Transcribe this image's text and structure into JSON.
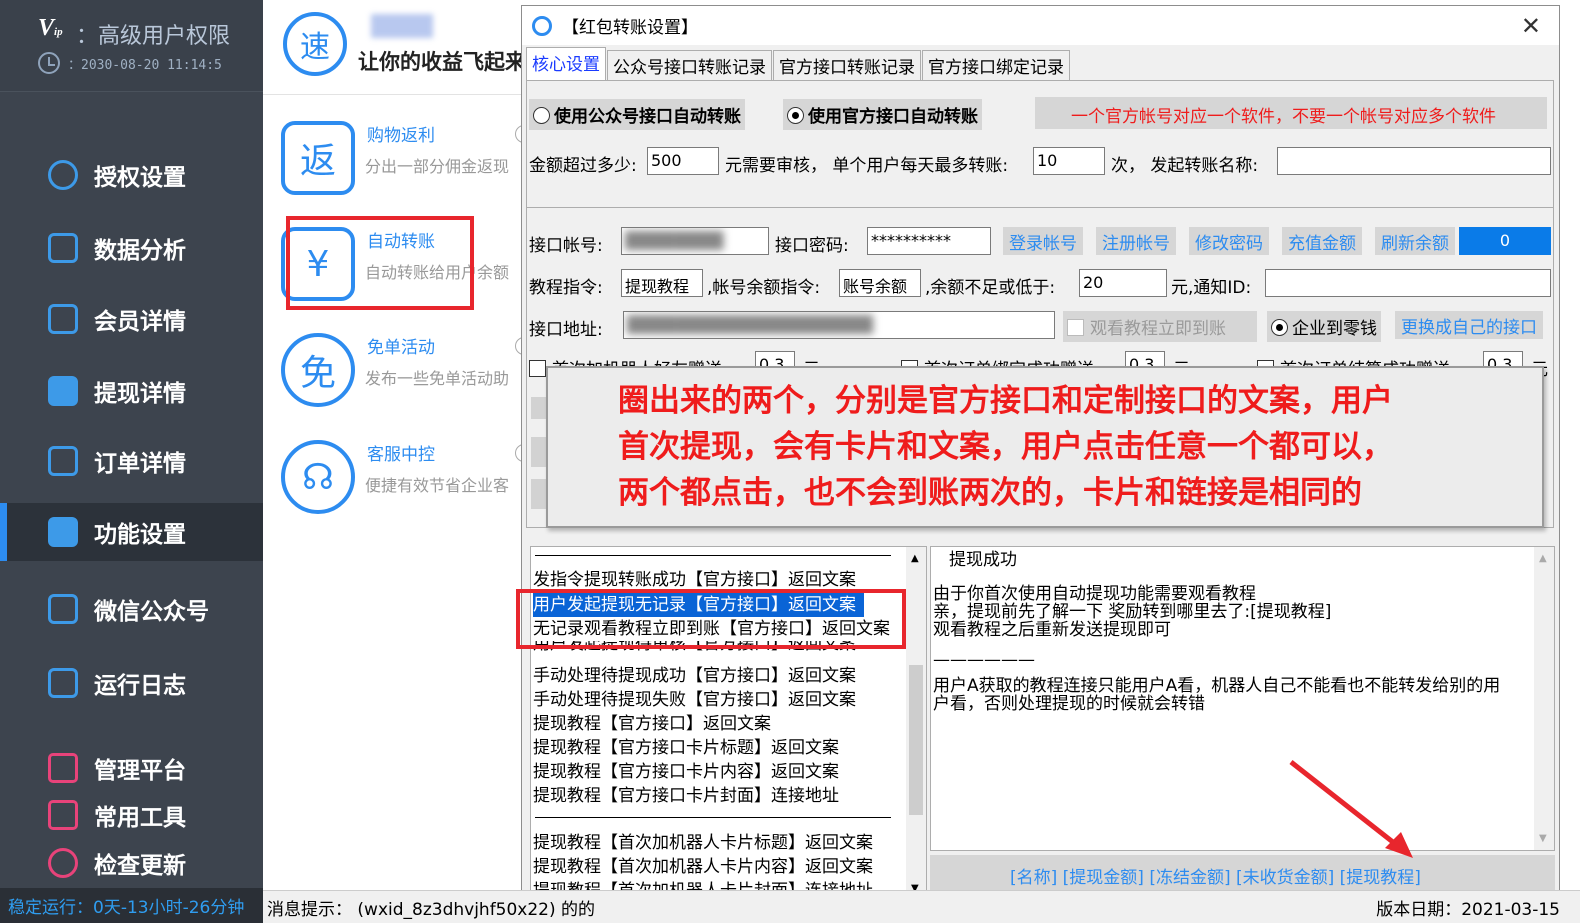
{
  "sidebar": {
    "vip_label": "：高级用户权限",
    "expiry": "：2030-08-20 11:14:5",
    "items": [
      {
        "label": "授权设置",
        "icon": "globe-icon"
      },
      {
        "label": "数据分析",
        "icon": "monitor-chart-icon"
      },
      {
        "label": "会员详情",
        "icon": "external-link-icon"
      },
      {
        "label": "提现详情",
        "icon": "grid-search-icon"
      },
      {
        "label": "订单详情",
        "icon": "document-yen-icon"
      },
      {
        "label": "功能设置",
        "icon": "wechat-icon"
      },
      {
        "label": "微信公众号",
        "icon": "wechat-official-icon"
      },
      {
        "label": "运行日志",
        "icon": "speaker-icon"
      },
      {
        "label": "管理平台",
        "icon": "platform-icon"
      },
      {
        "label": "常用工具",
        "icon": "tools-chart-icon"
      },
      {
        "label": "检查更新",
        "icon": "update-icon"
      }
    ],
    "uptime": "稳定运行：0天-13小时-26分钟"
  },
  "middle": {
    "logo_char": "速",
    "slogan": "让你的收益飞起来",
    "features": [
      {
        "icon_char": "返",
        "title": "购物返利",
        "desc": "分出一部分佣金返现"
      },
      {
        "icon_char": "¥",
        "title": "自动转账",
        "desc": "自动转账给用户余额"
      },
      {
        "icon_char": "免",
        "title": "免单活动",
        "desc": "发布一些免单活动助"
      },
      {
        "icon_char": "☊",
        "title": "客服中控",
        "desc": "便捷有效节省企业客"
      }
    ]
  },
  "dialog": {
    "title": "【红包转账设置】",
    "close": "✕",
    "tabs": [
      "核心设置",
      "公众号接口转账记录",
      "官方接口转账记录",
      "官方接口绑定记录"
    ],
    "mode_public": "使用公众号接口自动转账",
    "mode_official": "使用官方接口自动转账",
    "notice": "一个官方帐号对应一个软件，不要一个帐号对应多个软件",
    "amount_label": "金额超过多少:",
    "amount_value": "500",
    "review_label": "元需要审核， 单个用户每天最多转账:",
    "daily_value": "10",
    "name_label": "次， 发起转账名称:",
    "name_value": "",
    "account_label": "接口帐号:",
    "password_label": "接口密码:",
    "password_value": "**********",
    "btn_login": "登录帐号",
    "btn_register": "注册帐号",
    "btn_changepw": "修改密码",
    "btn_recharge": "充值金额",
    "btn_refresh": "刷新余额",
    "balance": "0",
    "tutorial_cmd_label": "教程指令:",
    "tutorial_cmd": "提现教程",
    "balance_cmd_label": ",帐号余额指令:",
    "balance_cmd": "账号余额",
    "low_label": ",余额不足或低于:",
    "low_value": "20",
    "notify_label": "元,通知ID:",
    "notify_value": "",
    "address_label": "接口地址:",
    "watch_label": "观看教程立即到账",
    "enterprise_label": "企业到零钱",
    "replace_btn": "更换成自己的接口",
    "row5a": "首次加机器人好友赠送:",
    "row5a_val": "0.3",
    "row5a_unit": "元",
    "row5b": "首次订单绑定成功赠送:",
    "row5b_val": "0.3",
    "row5b_unit": "元",
    "row5c": "首次订单结算成功赠送:",
    "row5c_val": "0.3",
    "row5c_unit": "元"
  },
  "list": {
    "items": [
      "发指令提现转账成功【官方接口】返回文案",
      "用户发起提现无记录【官方接口】返回文案",
      "无记录观看教程立即到账【官方接口】返回文案",
      "用户发起提现待审核【官方接口】返回文案",
      "手动处理待提现成功【官方接口】返回文案",
      "手动处理待提现失败【官方接口】返回文案",
      "提现教程【官方接口】返回文案",
      "提现教程【官方接口卡片标题】返回文案",
      "提现教程【官方接口卡片内容】返回文案",
      "提现教程【官方接口卡片封面】连接地址",
      "提现教程【首次加机器人卡片标题】返回文案",
      "提现教程【首次加机器人卡片内容】返回文案",
      "提现教程【首次加机器人卡片封面】连接地址"
    ]
  },
  "text": {
    "heading": "提现成功",
    "line1": "由于你首次使用自动提现功能需要观看教程",
    "line2": "亲，提现前先了解一下 奖励转到哪里去了:[提现教程]",
    "line3": "观看教程之后重新发送提现即可",
    "divider": "——————",
    "line4": "用户A获取的教程连接只能用户A看，机器人自己不能看也不能转发给别的用",
    "line5": "户看，否则处理提现的时候就会转错"
  },
  "vars": "[名称] [提现金额] [冻结金额] [未收货金额] [提现教程]",
  "callout": {
    "line1": "圈出来的两个，分别是官方接口和定制接口的文案，用户",
    "line2": "首次提现，会有卡片和文案，用户点击任意一个都可以，",
    "line3": "两个都点击，也不会到账两次的，卡片和链接是相同的"
  },
  "bottom": {
    "msg": "消息提示：  (wxid_8z3dhvjhf50x22) 的的",
    "version": "版本日期：2021-03-15"
  },
  "colors": {
    "accent": "#2d8cf0",
    "highlight": "#e8262d",
    "selection": "#0a64d6",
    "sidebar": "#3d444e"
  }
}
